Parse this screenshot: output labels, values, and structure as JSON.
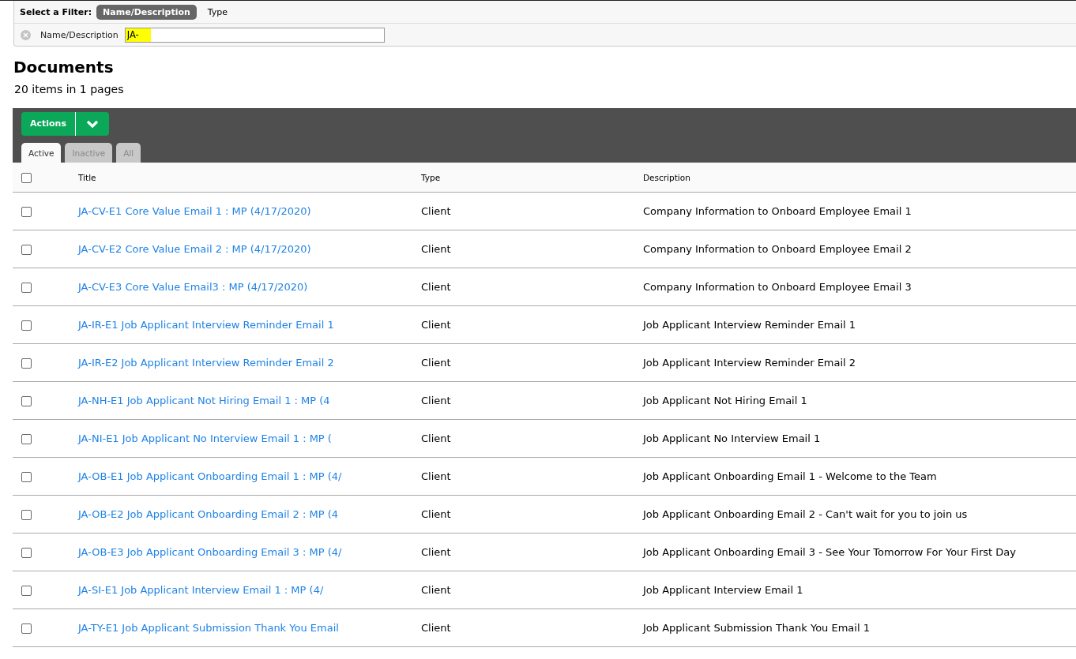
{
  "filter_bar": {
    "label": "Select a Filter:",
    "options": [
      {
        "label": "Name/Description",
        "selected": true
      },
      {
        "label": "Type",
        "selected": false
      }
    ]
  },
  "filter_field": {
    "label": "Name/Description",
    "value": "JA-",
    "highlighted": true
  },
  "heading": "Documents",
  "summary": "20 items in 1 pages",
  "actions_button": "Actions",
  "tabs": [
    {
      "label": "Active",
      "selected": true
    },
    {
      "label": "Inactive",
      "selected": false
    },
    {
      "label": "All",
      "selected": false
    }
  ],
  "table": {
    "select_all_checked": false,
    "columns": [
      "Title",
      "Type",
      "Description"
    ],
    "rows": [
      {
        "checked": false,
        "title": "JA-CV-E1 Core Value Email 1 : MP (4/17/2020)",
        "type": "Client",
        "description": "Company Information to Onboard Employee Email 1"
      },
      {
        "checked": false,
        "title": "JA-CV-E2 Core Value Email 2 : MP (4/17/2020)",
        "type": "Client",
        "description": "Company Information to Onboard Employee Email 2"
      },
      {
        "checked": false,
        "title": "JA-CV-E3 Core Value Email3 : MP (4/17/2020)",
        "type": "Client",
        "description": "Company Information to Onboard Employee Email 3"
      },
      {
        "checked": false,
        "title": "JA-IR-E1 Job Applicant Interview Reminder Email 1",
        "type": "Client",
        "description": "Job Applicant Interview Reminder Email 1"
      },
      {
        "checked": false,
        "title": "JA-IR-E2 Job Applicant Interview Reminder Email 2",
        "type": "Client",
        "description": "Job Applicant Interview Reminder Email 2"
      },
      {
        "checked": false,
        "title": "JA-NH-E1 Job Applicant Not Hiring Email 1 : MP (4",
        "type": "Client",
        "description": "Job Applicant Not Hiring Email 1"
      },
      {
        "checked": false,
        "title": "JA-NI-E1 Job Applicant No Interview Email 1 : MP (",
        "type": "Client",
        "description": "Job Applicant No Interview Email 1"
      },
      {
        "checked": false,
        "title": "JA-OB-E1 Job Applicant Onboarding Email 1 : MP (4/",
        "type": "Client",
        "description": "Job Applicant Onboarding Email 1 - Welcome to the Team"
      },
      {
        "checked": false,
        "title": "JA-OB-E2 Job Applicant Onboarding Email 2 : MP (4",
        "type": "Client",
        "description": "Job Applicant Onboarding Email 2 - Can't wait for you to join us"
      },
      {
        "checked": false,
        "title": "JA-OB-E3 Job Applicant Onboarding Email 3 : MP (4/",
        "type": "Client",
        "description": "Job Applicant Onboarding Email 3 - See Your Tomorrow For Your First Day"
      },
      {
        "checked": false,
        "title": "JA-SI-E1 Job Applicant Interview Email 1 : MP (4/",
        "type": "Client",
        "description": "Job Applicant Interview Email 1"
      },
      {
        "checked": false,
        "title": "JA-TY-E1 Job Applicant Submission Thank You Email",
        "type": "Client",
        "description": "Job Applicant Submission Thank You Email 1"
      }
    ]
  }
}
